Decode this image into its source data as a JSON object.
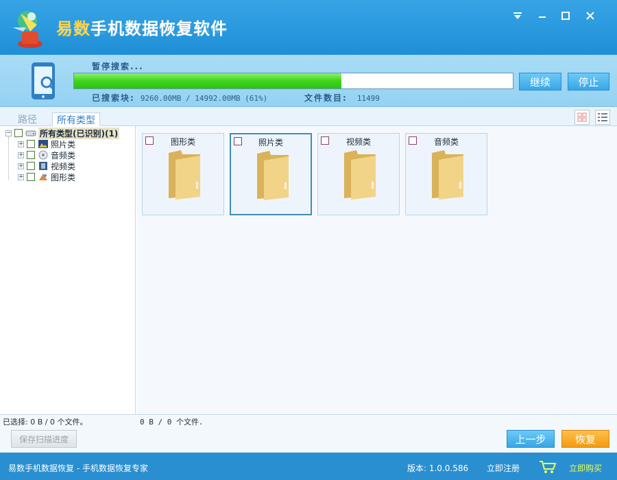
{
  "window": {
    "title_accent": "易数",
    "title_rest": "手机数据恢复软件",
    "controls": [
      "menu-icon",
      "minimize-icon",
      "maximize-icon",
      "close-icon"
    ]
  },
  "progress": {
    "status": "暂停搜索...",
    "percent": 61,
    "continue_label": "继续",
    "stop_label": "停止",
    "searched_label": "已搜索块:",
    "searched_value": "9260.00MB / 14992.00MB (61%)",
    "files_label": "文件数目:",
    "files_value": "11499"
  },
  "tabs": [
    {
      "label": "路径",
      "active": false
    },
    {
      "label": "所有类型",
      "active": true
    }
  ],
  "tree": {
    "root": "所有类型(已识别)(1)",
    "children": [
      {
        "label": "照片类",
        "icon": "photo-icon"
      },
      {
        "label": "音频类",
        "icon": "audio-icon"
      },
      {
        "label": "视频类",
        "icon": "video-icon"
      },
      {
        "label": "图形类",
        "icon": "graphic-icon"
      }
    ]
  },
  "cards": [
    {
      "label": "图形类",
      "selected": false
    },
    {
      "label": "照片类",
      "selected": true
    },
    {
      "label": "视频类",
      "selected": false
    },
    {
      "label": "音频类",
      "selected": false
    }
  ],
  "selection": {
    "left_text": "已选择: 0 B / 0 个文件。",
    "right_text": "0 B / 0 个文件."
  },
  "buttons": {
    "save_progress": "保存扫描进度",
    "back": "上一步",
    "recover": "恢复"
  },
  "footer": {
    "slogan": "易数手机数据恢复 - 手机数据恢复专家",
    "version": "版本: 1.0.0.586",
    "register": "立即注册",
    "buy": "立即购买"
  },
  "colors": {
    "titlebar": "#2a8fd0",
    "progress_fill": "#3fd51e",
    "accent_orange": "#f49a12"
  }
}
